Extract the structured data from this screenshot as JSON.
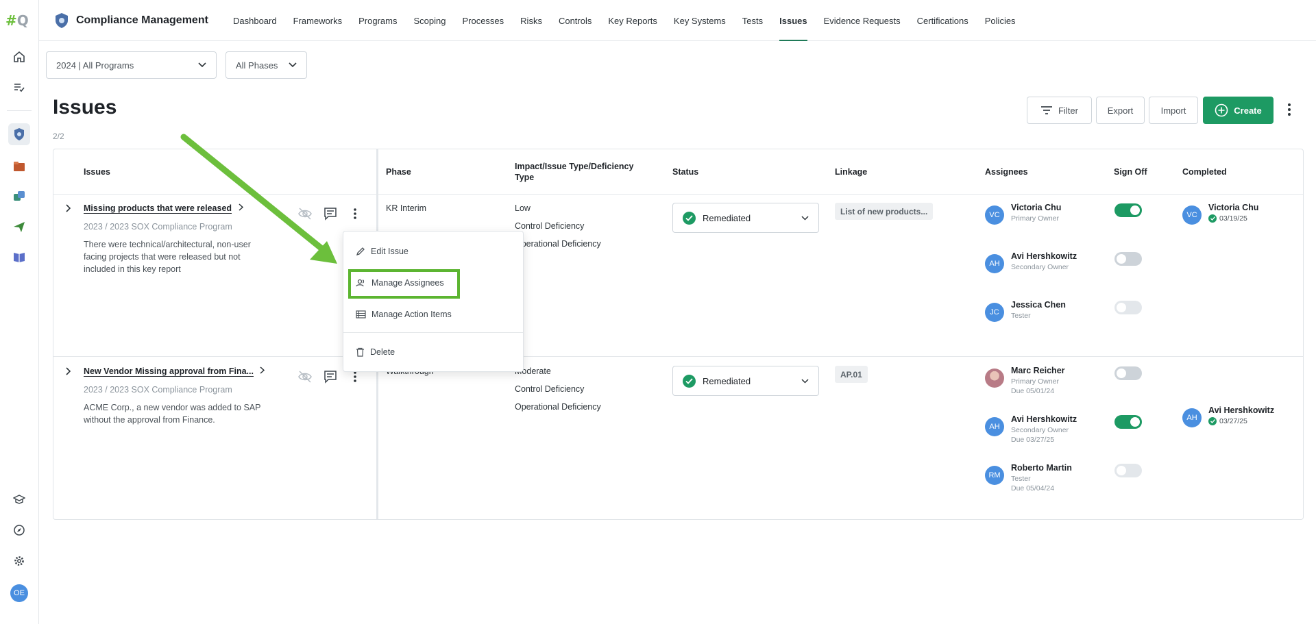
{
  "app": {
    "logo_hash": "#",
    "logo_q": "Q",
    "title": "Compliance Management",
    "user_initials": "OE"
  },
  "nav": {
    "items": [
      "Dashboard",
      "Frameworks",
      "Programs",
      "Scoping",
      "Processes",
      "Risks",
      "Controls",
      "Key Reports",
      "Key Systems",
      "Tests",
      "Issues",
      "Evidence Requests",
      "Certifications",
      "Policies"
    ],
    "active": "Issues"
  },
  "filters": {
    "program": "2024 | All Programs",
    "phase": "All Phases"
  },
  "page": {
    "title": "Issues",
    "count": "2/2"
  },
  "toolbar": {
    "filter": "Filter",
    "export": "Export",
    "import": "Import",
    "create": "Create"
  },
  "table": {
    "headers": {
      "issues": "Issues",
      "phase": "Phase",
      "impact": "Impact/Issue Type/Deficiency Type",
      "status": "Status",
      "linkage": "Linkage",
      "assignees": "Assignees",
      "signoff": "Sign Off",
      "completed": "Completed"
    },
    "rows": [
      {
        "title": "Missing products that were released",
        "program": "2023 / 2023 SOX Compliance Program",
        "description": "There were technical/architectural, non-user facing projects that were released but not included in this key report",
        "phase": "KR Interim",
        "impact": "Low",
        "issue_type": "Control Deficiency",
        "deficiency_type": "Operational Deficiency",
        "status": "Remediated",
        "linkage": "List of new products...",
        "assignees": [
          {
            "initials": "VC",
            "name": "Victoria Chu",
            "role": "Primary Owner",
            "due": "",
            "signed_off": true
          },
          {
            "initials": "AH",
            "name": "Avi Hershkowitz",
            "role": "Secondary Owner",
            "due": "",
            "signed_off": false
          },
          {
            "initials": "JC",
            "name": "Jessica Chen",
            "role": "Tester",
            "due": "",
            "signed_off": false
          }
        ],
        "completed": {
          "initials": "VC",
          "name": "Victoria Chu",
          "date": "03/19/25"
        }
      },
      {
        "title": "New Vendor Missing approval from Fina...",
        "program": "2023 / 2023 SOX Compliance Program",
        "description": "ACME Corp., a new vendor was added to SAP without the approval from Finance.",
        "phase": "Walkthrough",
        "impact": "Moderate",
        "issue_type": "Control Deficiency",
        "deficiency_type": "Operational Deficiency",
        "status": "Remediated",
        "linkage": "AP.01",
        "assignees": [
          {
            "initials": "",
            "name": "Marc Reicher",
            "role": "Primary Owner",
            "due": "Due 05/01/24",
            "signed_off": false
          },
          {
            "initials": "AH",
            "name": "Avi Hershkowitz",
            "role": "Secondary Owner",
            "due": "Due 03/27/25",
            "signed_off": true
          },
          {
            "initials": "RM",
            "name": "Roberto Martin",
            "role": "Tester",
            "due": "Due 05/04/24",
            "signed_off": false
          }
        ],
        "completed": {
          "initials": "AH",
          "name": "Avi Hershkowitz",
          "date": "03/27/25"
        }
      }
    ]
  },
  "context_menu": {
    "items": [
      "Edit Issue",
      "Manage Assignees",
      "Manage Action Items",
      "Delete"
    ],
    "highlighted": "Manage Assignees"
  },
  "colors": {
    "accent_green": "#1d9a63",
    "highlight_green": "#5cb531",
    "avatar_blue": "#4a8fe0"
  }
}
